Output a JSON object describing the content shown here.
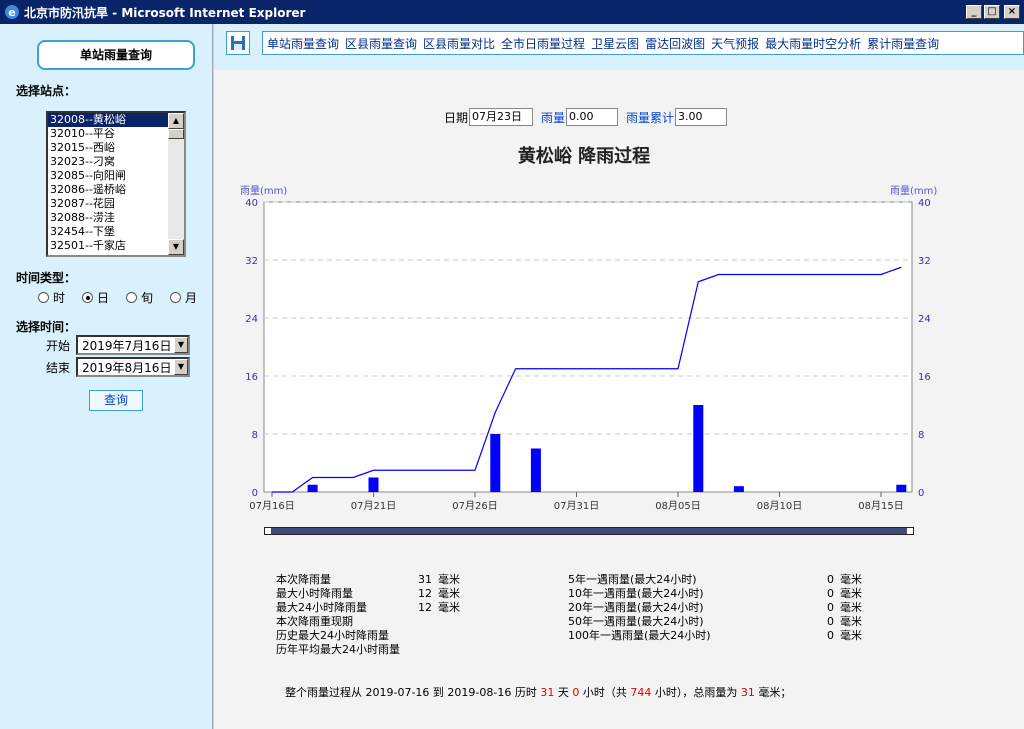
{
  "window": {
    "title": "北京市防汛抗旱 - Microsoft Internet Explorer"
  },
  "sidebar": {
    "title": "单站雨量查询",
    "station_label": "选择站点：",
    "stations": [
      "32008--黄松峪",
      "32010--平谷",
      "32015--西峪",
      "32023--刁窝",
      "32085--向阳闸",
      "32086--遥桥峪",
      "32087--花园",
      "32088--涝洼",
      "32454--下堡",
      "32501--千家店"
    ],
    "selected_station_index": 0,
    "time_type_label": "时间类型：",
    "time_types": [
      "时",
      "日",
      "旬",
      "月"
    ],
    "time_type_selected": 1,
    "time_select_label": "选择时间：",
    "start_label": "开始",
    "start_date": "2019年7月16日",
    "end_label": "结束",
    "end_date": "2019年8月16日",
    "query_button": "查询"
  },
  "nav": {
    "links": [
      "单站雨量查询",
      "区县雨量查询",
      "区县雨量对比",
      "全市日雨量过程",
      "卫星云图",
      "雷达回波图",
      "天气预报",
      "最大雨量时空分析",
      "累计雨量查询"
    ]
  },
  "params": {
    "date_label": "日期",
    "date_value": "07月23日",
    "rain_label": "雨量",
    "rain_value": "0.00",
    "cum_label": "雨量累计",
    "cum_value": "3.00"
  },
  "chart_title": "黄松峪 降雨过程",
  "chart_data": {
    "type": "bar+line",
    "ylabel_left": "雨量(mm)",
    "ylabel_right": "雨量(mm)",
    "ylim": [
      0,
      40
    ],
    "yticks": [
      0,
      8,
      16,
      24,
      32,
      40
    ],
    "xticks": [
      "07月16日",
      "07月21日",
      "07月26日",
      "07月31日",
      "08月05日",
      "08月10日",
      "08月15日"
    ],
    "dates": [
      "07-16",
      "07-17",
      "07-18",
      "07-19",
      "07-20",
      "07-21",
      "07-22",
      "07-23",
      "07-24",
      "07-25",
      "07-26",
      "07-27",
      "07-28",
      "07-29",
      "07-30",
      "07-31",
      "08-01",
      "08-02",
      "08-03",
      "08-04",
      "08-05",
      "08-06",
      "08-07",
      "08-08",
      "08-09",
      "08-10",
      "08-11",
      "08-12",
      "08-13",
      "08-14",
      "08-15",
      "08-16"
    ],
    "series": [
      {
        "name": "daily",
        "color": "#0000ff",
        "values": [
          0,
          0,
          1,
          0,
          0,
          2,
          0,
          0,
          0,
          0,
          0,
          8,
          0,
          6,
          0,
          0,
          0,
          0,
          0,
          0,
          0,
          12,
          0,
          0.8,
          0,
          0,
          0,
          0,
          0,
          0,
          0,
          1
        ]
      },
      {
        "name": "cumulative",
        "color": "#0000ff",
        "values": [
          0,
          0,
          2,
          2,
          2,
          3,
          3,
          3,
          3,
          3,
          3,
          11,
          17,
          17,
          17,
          17,
          17,
          17,
          17,
          17,
          17,
          29,
          30,
          30,
          30,
          30,
          30,
          30,
          30,
          30,
          30,
          31
        ]
      }
    ]
  },
  "stats_left": [
    {
      "label": "本次降雨量",
      "value": "31",
      "unit": "毫米"
    },
    {
      "label": "最大小时降雨量",
      "value": "12",
      "unit": "毫米"
    },
    {
      "label": "最大24小时降雨量",
      "value": "12",
      "unit": "毫米"
    },
    {
      "label": "本次降雨重现期",
      "value": "",
      "unit": ""
    },
    {
      "label": "历史最大24小时降雨量",
      "value": "",
      "unit": ""
    },
    {
      "label": "历年平均最大24小时雨量",
      "value": "",
      "unit": ""
    }
  ],
  "stats_right": [
    {
      "label": "5年一遇雨量(最大24小时)",
      "value": "0",
      "unit": "毫米"
    },
    {
      "label": "10年一遇雨量(最大24小时)",
      "value": "0",
      "unit": "毫米"
    },
    {
      "label": "20年一遇雨量(最大24小时)",
      "value": "0",
      "unit": "毫米"
    },
    {
      "label": "50年一遇雨量(最大24小时)",
      "value": "0",
      "unit": "毫米"
    },
    {
      "label": "100年一遇雨量(最大24小时)",
      "value": "0",
      "unit": "毫米"
    }
  ],
  "summary": {
    "prefix": "整个雨量过程从 2019-07-16 到 2019-08-16 历时 ",
    "days": "31",
    "days_unit": " 天 ",
    "hours": "0",
    "hours_unit": " 小时（共 ",
    "total_hours": "744",
    "mid": " 小时），总雨量为 ",
    "total_rain": "31",
    "suffix": " 毫米；"
  }
}
